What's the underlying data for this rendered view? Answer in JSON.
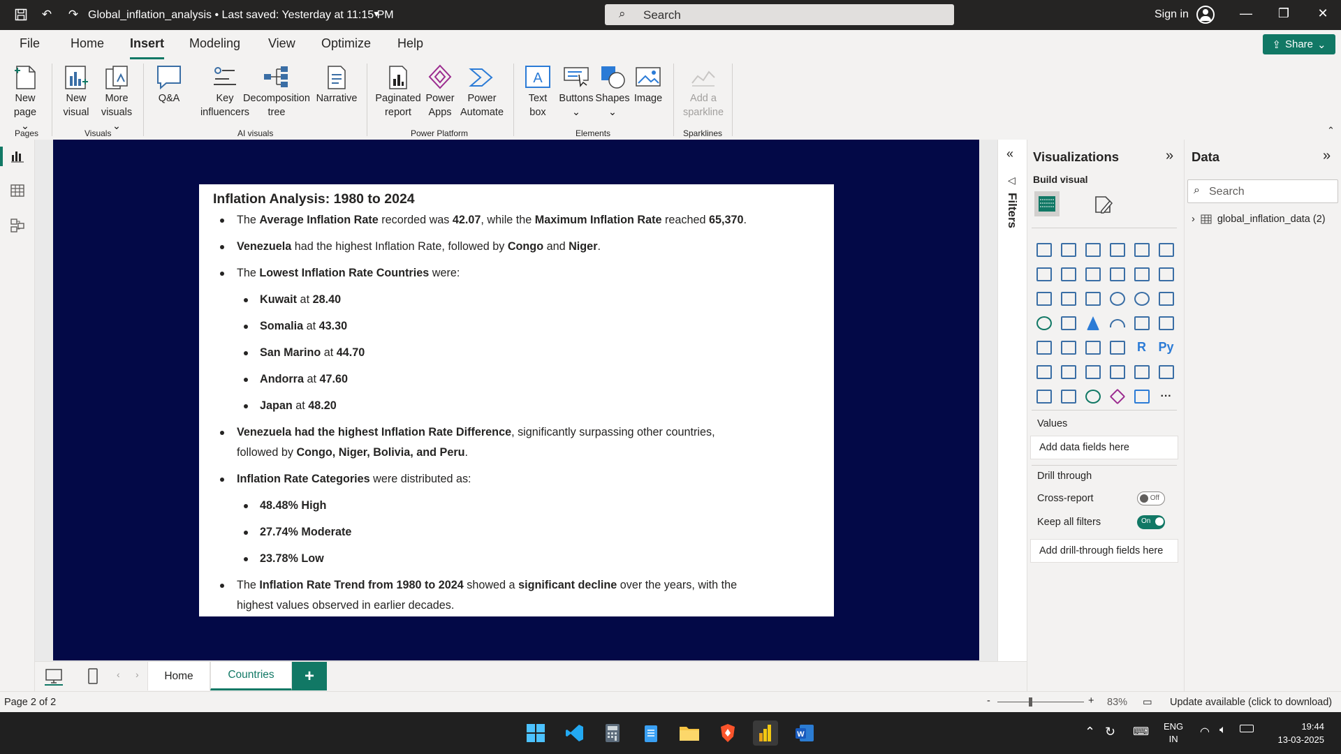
{
  "titlebar": {
    "doc_title": "Global_inflation_analysis • Last saved: Yesterday at 11:15 PM",
    "search_placeholder": "Search",
    "signin": "Sign in"
  },
  "menu": {
    "items": [
      "File",
      "Home",
      "Insert",
      "Modeling",
      "View",
      "Optimize",
      "Help"
    ],
    "active": "Insert",
    "share": "Share"
  },
  "ribbon": {
    "new_page": [
      "New",
      "page"
    ],
    "new_visual": [
      "New",
      "visual"
    ],
    "more_visuals": [
      "More",
      "visuals"
    ],
    "qa": "Q&A",
    "key_influencers": [
      "Key",
      "influencers"
    ],
    "decomposition_tree": [
      "Decomposition",
      "tree"
    ],
    "narrative": "Narrative",
    "paginated_report": [
      "Paginated",
      "report"
    ],
    "power_apps": [
      "Power",
      "Apps"
    ],
    "power_automate": [
      "Power",
      "Automate"
    ],
    "text_box": [
      "Text",
      "box"
    ],
    "buttons": "Buttons",
    "shapes": "Shapes",
    "image": "Image",
    "sparkline": [
      "Add a",
      "sparkline"
    ],
    "groups": [
      "Pages",
      "Visuals",
      "AI visuals",
      "Power Platform",
      "Elements",
      "Sparklines"
    ]
  },
  "report": {
    "title": "Inflation Analysis: 1980 to 2024",
    "bullets": {
      "b1": {
        "p1": "The ",
        "s1": "Average Inflation Rate",
        "p2": " recorded was ",
        "s2": "42.07",
        "p3": ", while the ",
        "s3": "Maximum Inflation Rate",
        "p4": " reached ",
        "s4": "65,370",
        "p5": "."
      },
      "b2": {
        "s1": "Venezuela",
        "p1": " had the highest Inflation Rate, followed by ",
        "s2": "Congo",
        "p2": " and ",
        "s3": "Niger",
        "p3": "."
      },
      "b3": {
        "p1": "The ",
        "s1": "Lowest Inflation Rate Countries",
        "p2": " were:"
      },
      "lowest": [
        {
          "country": "Kuwait",
          "at": " at ",
          "value": "28.40"
        },
        {
          "country": "Somalia",
          "at": " at ",
          "value": "43.30"
        },
        {
          "country": "San Marino",
          "at": " at ",
          "value": "44.70"
        },
        {
          "country": "Andorra",
          "at": " at ",
          "value": "47.60"
        },
        {
          "country": "Japan",
          "at": " at ",
          "value": "48.20"
        }
      ],
      "b4": {
        "s1": "Venezuela had the highest Inflation Rate Difference",
        "p1": ", significantly surpassing other countries, followed by ",
        "s2": "Congo, Niger, Bolivia, and Peru",
        "p2": "."
      },
      "b5": {
        "s1": "Inflation Rate Categories",
        "p1": " were distributed as:"
      },
      "categories": [
        "48.48% High",
        "27.74% Moderate",
        "23.78% Low"
      ],
      "b6": {
        "p1": "The ",
        "s1": "Inflation Rate Trend from 1980 to 2024",
        "p2": " showed a ",
        "s2": "significant decline",
        "p3": " over the years, with the highest values observed in earlier decades."
      }
    }
  },
  "filters_label": "Filters",
  "viz": {
    "title": "Visualizations",
    "build_visual": "Build visual",
    "values": "Values",
    "add_data_fields": "Add data fields here",
    "drill_through": "Drill through",
    "cross_report": "Cross-report",
    "cross_report_state": "Off",
    "keep_all_filters": "Keep all filters",
    "keep_all_filters_state": "On",
    "add_drill_fields": "Add drill-through fields here",
    "r_label": "R",
    "py_label": "Py",
    "more": "···"
  },
  "data_pane": {
    "title": "Data",
    "search_placeholder": "Search",
    "table": "global_inflation_data (2)"
  },
  "tabs": {
    "items": [
      "Home",
      "Countries"
    ],
    "active": "Countries",
    "add": "+"
  },
  "status": {
    "page": "Page 2 of 2",
    "zoom_minus": "-",
    "zoom_plus": "+",
    "zoom": "83%",
    "update": "Update available (click to download)"
  },
  "taskbar": {
    "lang1": "ENG",
    "lang2": "IN",
    "time": "19:44",
    "date": "13-03-2025"
  },
  "colors": {
    "accent": "#117865",
    "canvas": "#030947",
    "titlebar": "#252423"
  }
}
